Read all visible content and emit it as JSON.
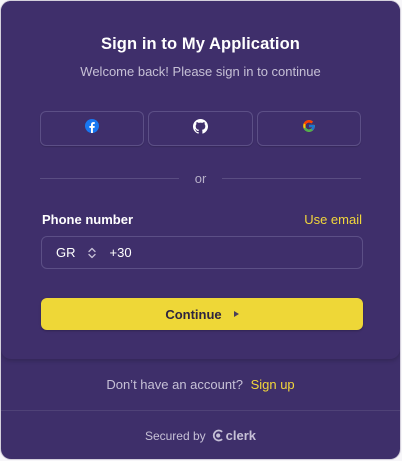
{
  "header": {
    "title": "Sign in to My Application",
    "subtitle": "Welcome back! Please sign in to continue"
  },
  "social": [
    {
      "provider": "facebook",
      "icon": "facebook-icon"
    },
    {
      "provider": "github",
      "icon": "github-icon"
    },
    {
      "provider": "google",
      "icon": "google-icon"
    }
  ],
  "divider": {
    "label": "or"
  },
  "phone": {
    "label": "Phone number",
    "switch_label": "Use email",
    "country_code": "GR",
    "dial_prefix": "+30",
    "value": ""
  },
  "continue": {
    "label": "Continue"
  },
  "footer": {
    "prompt": "Don’t have an account?",
    "signup_label": "Sign up",
    "secured_by": "Secured by",
    "brand": "clerk"
  },
  "colors": {
    "background": "#3f2f6b",
    "accent": "#eed737",
    "link": "#f2d73b"
  }
}
